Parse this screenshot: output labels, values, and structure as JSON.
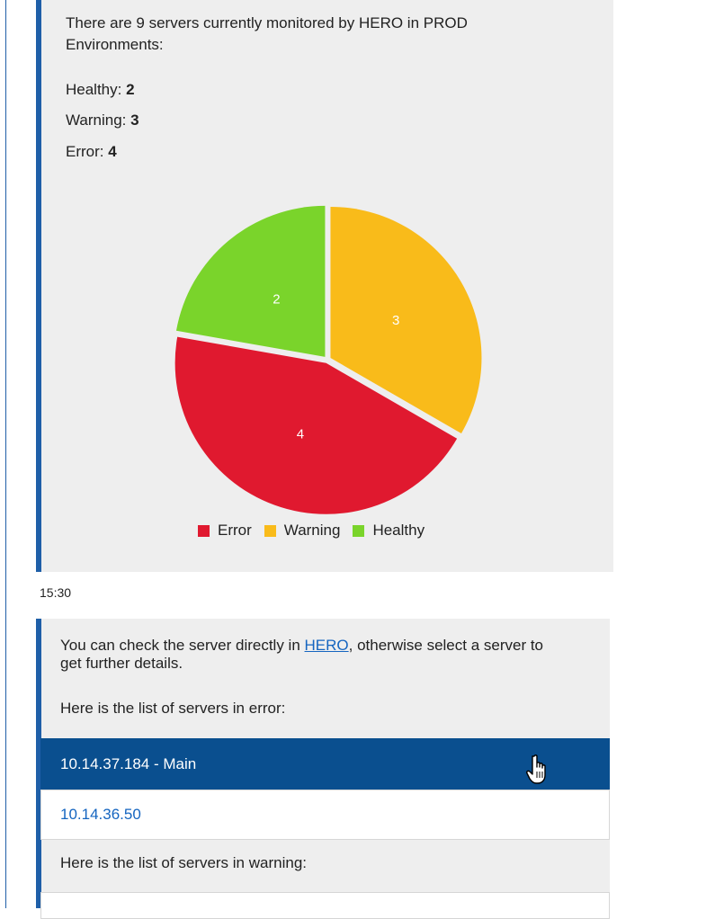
{
  "message1": {
    "intro": "There are 9 servers currently monitored by HERO in PROD Environments:",
    "healthy_label": "Healthy:",
    "healthy_count": "2",
    "warning_label": "Warning:",
    "warning_count": "3",
    "error_label": "Error:",
    "error_count": "4"
  },
  "chart_data": {
    "type": "pie",
    "categories": [
      "Warning",
      "Error",
      "Healthy"
    ],
    "values": [
      3,
      4,
      2
    ],
    "labels": [
      "3",
      "4",
      "2"
    ],
    "colors": [
      "#f9bb1a",
      "#e0192f",
      "#7ad42b"
    ],
    "legend": [
      {
        "label": "Error",
        "color": "#e0192f"
      },
      {
        "label": "Warning",
        "color": "#f9bb1a"
      },
      {
        "label": "Healthy",
        "color": "#7ad42b"
      }
    ],
    "legend_position": "bottom"
  },
  "timestamp": "15:30",
  "message2": {
    "text_before_link": "You can check the server directly in ",
    "link_text": "HERO",
    "text_after_link": ", otherwise select a server to get further details.",
    "error_list_heading": "Here is the list of servers in error:",
    "error_servers": [
      "10.14.37.184 - Main",
      "10.14.36.50"
    ],
    "warning_list_heading": "Here is the list of servers in warning:"
  },
  "colors": {
    "accent": "#1f5fa8",
    "selected_row": "#0a4f8f",
    "link": "#1565c0",
    "bubble_bg": "#eeeeee"
  }
}
